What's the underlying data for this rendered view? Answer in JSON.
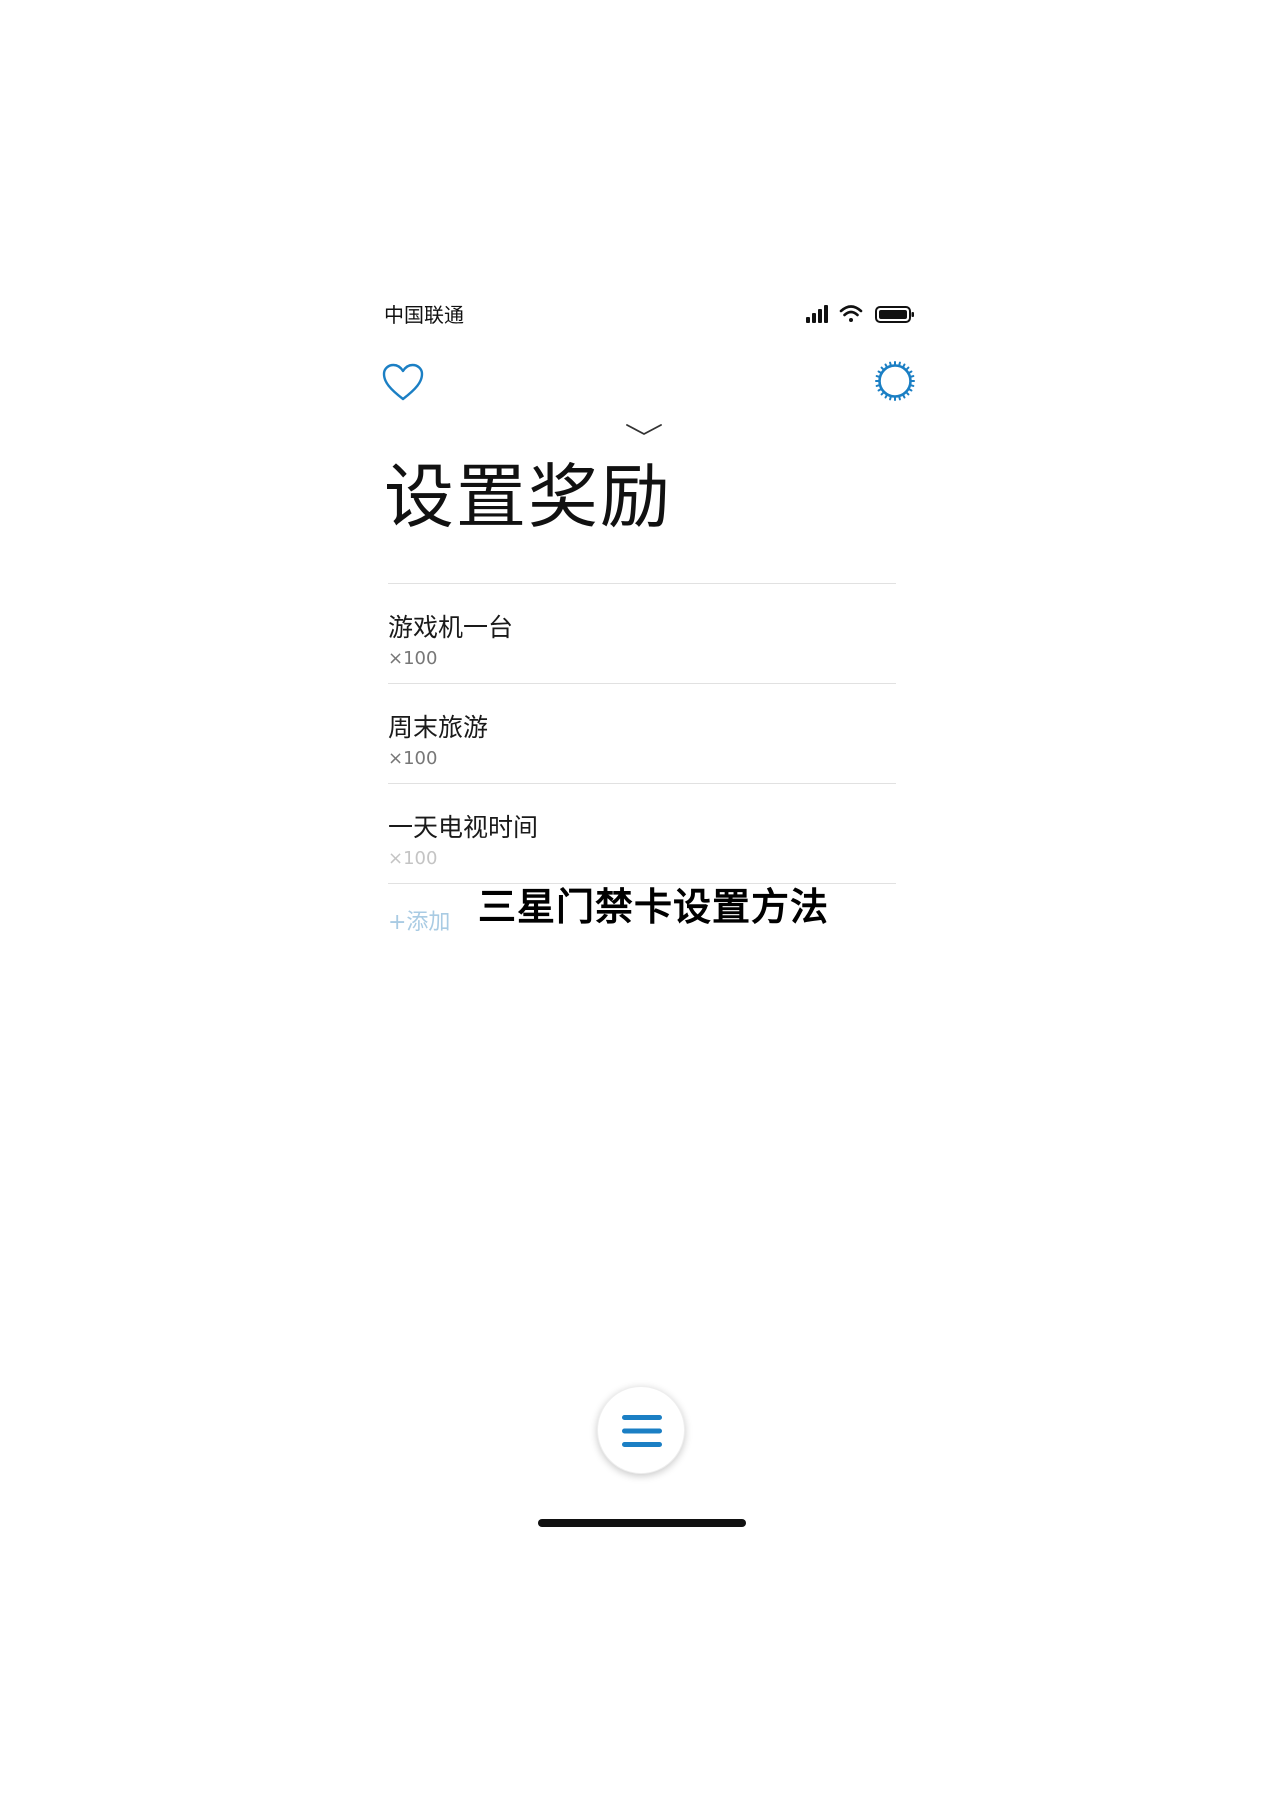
{
  "status_bar": {
    "carrier": "中国联通",
    "icons": [
      "signal-icon",
      "wifi-icon",
      "battery-icon"
    ]
  },
  "header": {
    "left_icon": "heart-icon",
    "right_icon": "gear-icon",
    "collapse_icon": "chevron-down-icon"
  },
  "page": {
    "title": "设置奖励"
  },
  "rewards": [
    {
      "name": "游戏机一台",
      "cost": "×100"
    },
    {
      "name": "周末旅游",
      "cost": "×100"
    },
    {
      "name": "一天电视时间",
      "cost": "×100"
    }
  ],
  "add_label": "+添加",
  "overlay_caption": "三星门禁卡设置方法",
  "menu_button": {
    "icon": "menu-icon"
  },
  "colors": {
    "accent": "#1b7fc4",
    "add_text": "#a9cbe3",
    "divider": "#e1e1e1"
  }
}
